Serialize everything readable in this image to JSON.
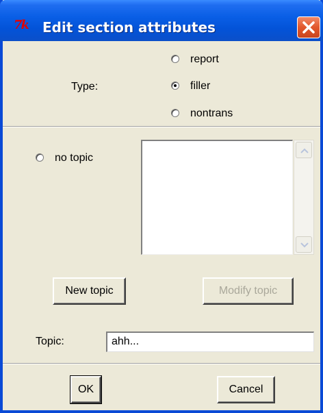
{
  "window": {
    "title": "Edit section attributes",
    "icon": "tk-icon",
    "close_icon": "close-icon"
  },
  "type_section": {
    "label": "Type:",
    "options": [
      {
        "label": "report",
        "checked": false
      },
      {
        "label": "filler",
        "checked": true
      },
      {
        "label": "nontrans",
        "checked": false
      }
    ]
  },
  "topic_section": {
    "no_topic_label": "no topic",
    "no_topic_checked": false,
    "list_items": [],
    "new_topic_label": "New topic",
    "modify_topic_label": "Modify topic",
    "modify_topic_enabled": false,
    "topic_label": "Topic:",
    "topic_value": "ahh..."
  },
  "footer": {
    "ok_label": "OK",
    "cancel_label": "Cancel"
  },
  "colors": {
    "titlebar": "#0353d8",
    "dialog_bg": "#ece9d8",
    "close_button": "#e2572c"
  }
}
